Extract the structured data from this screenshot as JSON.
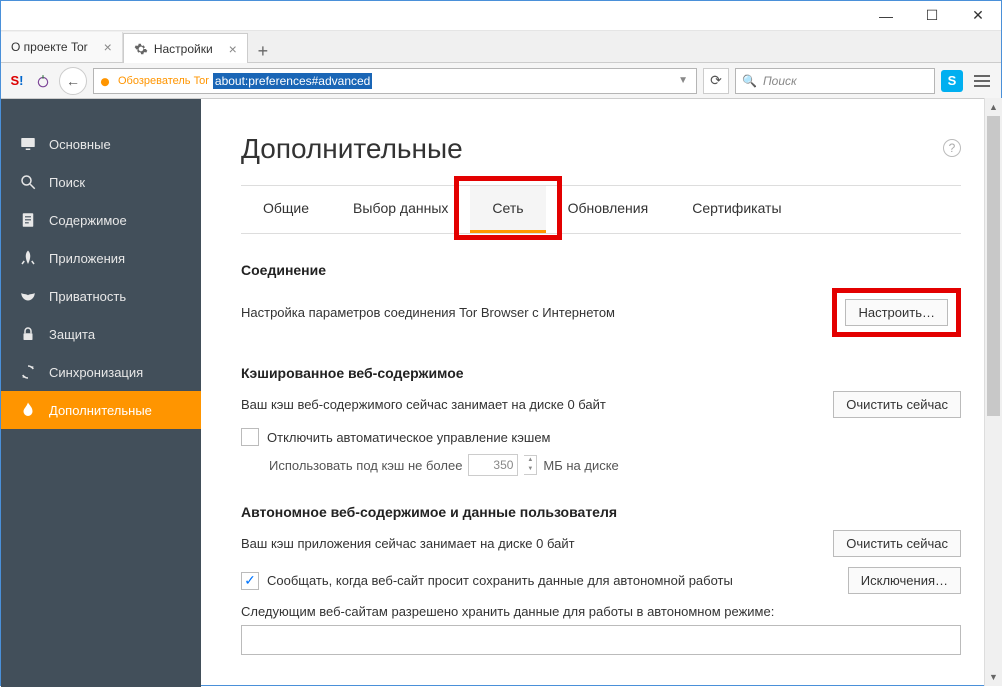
{
  "window": {
    "minimize": "—",
    "maximize": "☐",
    "close": "✕"
  },
  "tabs": [
    {
      "label": "О проекте Tor",
      "active": false,
      "icon": "none"
    },
    {
      "label": "Настройки",
      "active": true,
      "icon": "gear"
    }
  ],
  "new_tab": "+",
  "toolbar": {
    "back": "←",
    "identity_label": "Обозреватель Tor",
    "url": "about:preferences#advanced",
    "dropdown": "▼",
    "reload": "⟳",
    "search_placeholder": "Поиск",
    "skype": "S",
    "menu": "≡"
  },
  "sidebar": {
    "items": [
      {
        "label": "Основные",
        "icon": "monitor"
      },
      {
        "label": "Поиск",
        "icon": "search"
      },
      {
        "label": "Содержимое",
        "icon": "document"
      },
      {
        "label": "Приложения",
        "icon": "rocket"
      },
      {
        "label": "Приватность",
        "icon": "mask"
      },
      {
        "label": "Защита",
        "icon": "lock"
      },
      {
        "label": "Синхронизация",
        "icon": "sync"
      },
      {
        "label": "Дополнительные",
        "icon": "flame",
        "selected": true
      }
    ]
  },
  "main": {
    "title": "Дополнительные",
    "help": "?",
    "subtabs": [
      {
        "label": "Общие"
      },
      {
        "label": "Выбор данных"
      },
      {
        "label": "Сеть",
        "active": true,
        "highlight": true
      },
      {
        "label": "Обновления"
      },
      {
        "label": "Сертификаты"
      }
    ],
    "connection": {
      "heading": "Соединение",
      "desc": "Настройка параметров соединения Tor Browser с Интернетом",
      "btn": "Настроить…"
    },
    "cache": {
      "heading": "Кэшированное веб-содержимое",
      "desc": "Ваш кэш веб-содержимого сейчас занимает на диске 0 байт",
      "btn": "Очистить сейчас",
      "chk_label": "Отключить автоматическое управление кэшем",
      "limit_pre": "Использовать под кэш не более",
      "limit_val": "350",
      "limit_post": "МБ на диске"
    },
    "offline": {
      "heading": "Автономное веб-содержимое и данные пользователя",
      "desc": "Ваш кэш приложения сейчас занимает на диске 0 байт",
      "btn_clear": "Очистить сейчас",
      "chk_label": "Сообщать, когда веб-сайт просит сохранить данные для автономной работы",
      "btn_exc": "Исключения…",
      "list_label": "Следующим веб-сайтам разрешено хранить данные для работы в автономном режиме:"
    }
  }
}
